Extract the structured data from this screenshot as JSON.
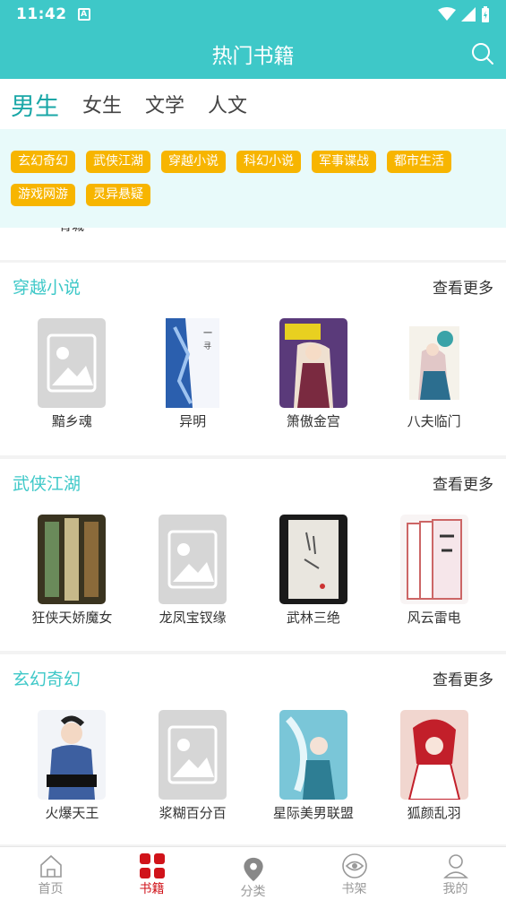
{
  "status": {
    "time": "11:42",
    "a_badge": "A"
  },
  "header": {
    "title": "热门书籍"
  },
  "tabs": [
    {
      "label": "男生",
      "active": true
    },
    {
      "label": "女生",
      "active": false
    },
    {
      "label": "文学",
      "active": false
    },
    {
      "label": "人文",
      "active": false
    }
  ],
  "tags": [
    "玄幻奇幻",
    "武侠江湖",
    "穿越小说",
    "科幻小说",
    "军事谍战",
    "都市生活",
    "游戏网游",
    "灵异悬疑"
  ],
  "peek_text": "青城",
  "sections": [
    {
      "title": "穿越小说",
      "more": "查看更多",
      "books": [
        {
          "name": "黯乡魂",
          "cover": "placeholder"
        },
        {
          "name": "异明",
          "cover": "cover-blue-white"
        },
        {
          "name": "箫傲金宫",
          "cover": "cover-purple-anime"
        },
        {
          "name": "八夫临门",
          "cover": "cover-white-teal"
        }
      ]
    },
    {
      "title": "武侠江湖",
      "more": "查看更多",
      "books": [
        {
          "name": "狂侠天娇魔女",
          "cover": "cover-dark-banners"
        },
        {
          "name": "龙凤宝钗缘",
          "cover": "placeholder"
        },
        {
          "name": "武林三绝",
          "cover": "cover-white-ink"
        },
        {
          "name": "风云雷电",
          "cover": "cover-pink-books"
        }
      ]
    },
    {
      "title": "玄幻奇幻",
      "more": "查看更多",
      "books": [
        {
          "name": "火爆天王",
          "cover": "cover-white-hero"
        },
        {
          "name": "浆糊百分百",
          "cover": "placeholder"
        },
        {
          "name": "星际美男联盟",
          "cover": "cover-teal-anime"
        },
        {
          "name": "狐颜乱羽",
          "cover": "cover-red-anime"
        }
      ]
    }
  ],
  "bottom_nav": [
    {
      "label": "首页",
      "icon": "home-icon",
      "active": false
    },
    {
      "label": "书籍",
      "icon": "grid-icon",
      "active": true
    },
    {
      "label": "分类",
      "icon": "location-pin-icon",
      "active": false
    },
    {
      "label": "书架",
      "icon": "eye-icon",
      "active": false
    },
    {
      "label": "我的",
      "icon": "person-icon",
      "active": false
    }
  ],
  "colors": {
    "accent": "#3ec8c8",
    "tag": "#f7b500",
    "active_nav": "#d0131a"
  }
}
